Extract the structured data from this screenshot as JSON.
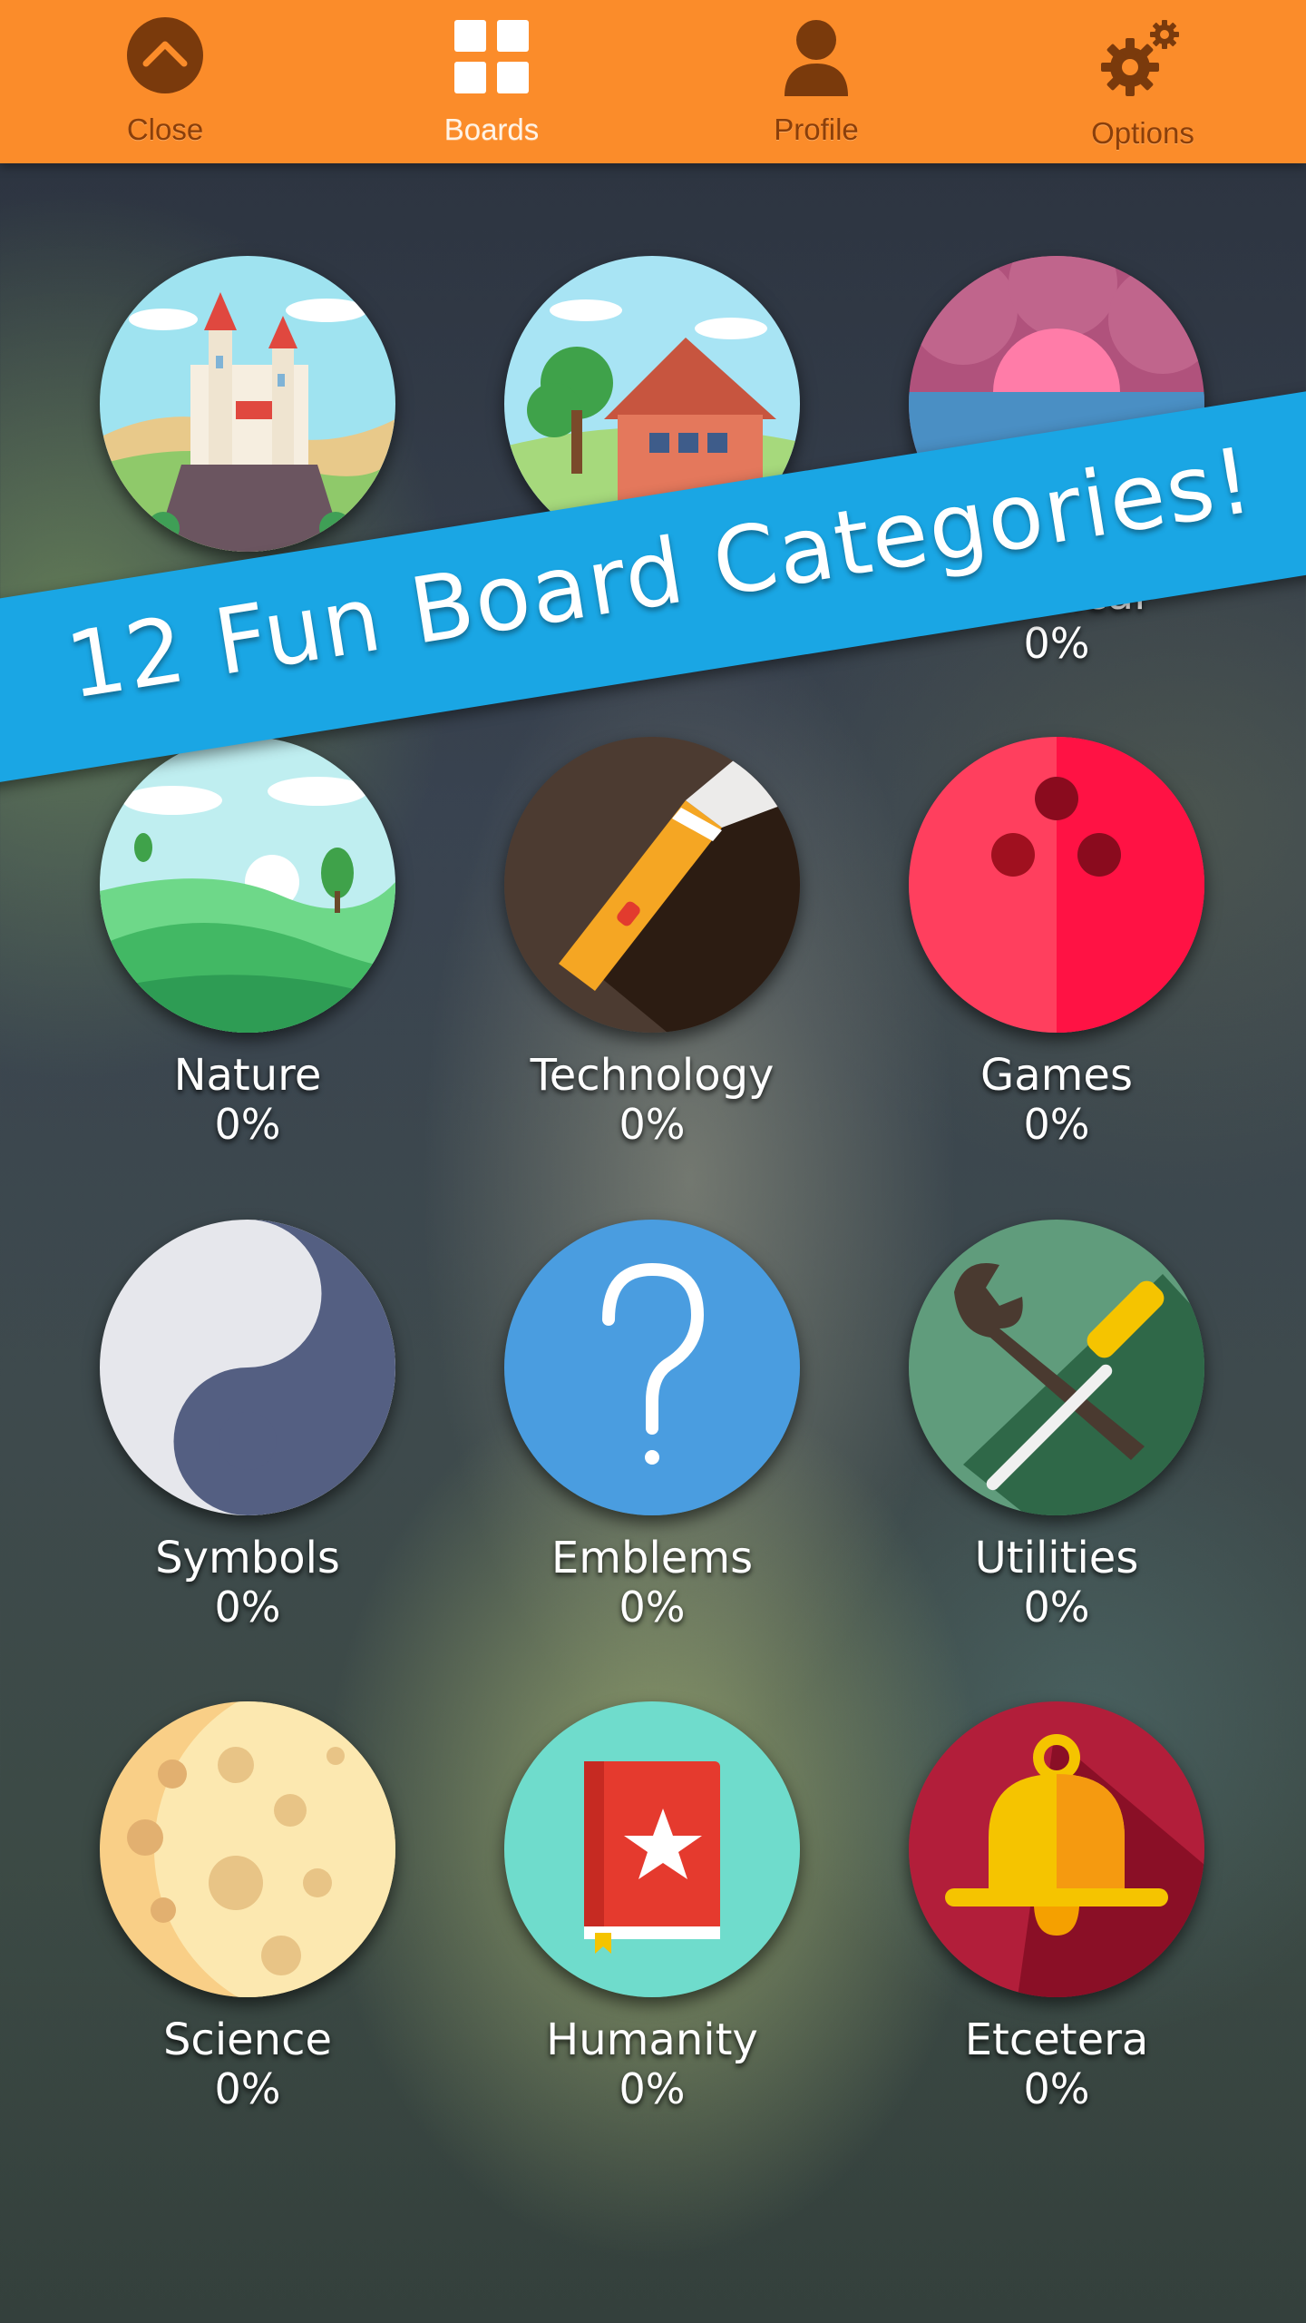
{
  "nav": {
    "items": [
      {
        "label": "Close",
        "icon": "chevron-up-icon"
      },
      {
        "label": "Boards",
        "icon": "grid-icon"
      },
      {
        "label": "Profile",
        "icon": "person-icon"
      },
      {
        "label": "Options",
        "icon": "gears-icon"
      }
    ],
    "active": "Boards",
    "bar_color": "#fb8c2a"
  },
  "banner": {
    "text": "12 Fun Board Categories!",
    "color": "#1aa6e4"
  },
  "categories": [
    {
      "name": "",
      "percent": "",
      "icon": "castle-icon"
    },
    {
      "name": "",
      "percent": "",
      "icon": "house-icon"
    },
    {
      "name": "Nautical",
      "percent": "0%",
      "icon": "sunset-clouds-icon"
    },
    {
      "name": "Nature",
      "percent": "0%",
      "icon": "hills-icon"
    },
    {
      "name": "Technology",
      "percent": "0%",
      "icon": "flashlight-icon"
    },
    {
      "name": "Games",
      "percent": "0%",
      "icon": "bowling-ball-icon"
    },
    {
      "name": "Symbols",
      "percent": "0%",
      "icon": "yin-yang-icon"
    },
    {
      "name": "Emblems",
      "percent": "0%",
      "icon": "question-mark-icon"
    },
    {
      "name": "Utilities",
      "percent": "0%",
      "icon": "tools-icon"
    },
    {
      "name": "Science",
      "percent": "0%",
      "icon": "moon-icon"
    },
    {
      "name": "Humanity",
      "percent": "0%",
      "icon": "book-icon"
    },
    {
      "name": "Etcetera",
      "percent": "0%",
      "icon": "bell-icon"
    }
  ]
}
